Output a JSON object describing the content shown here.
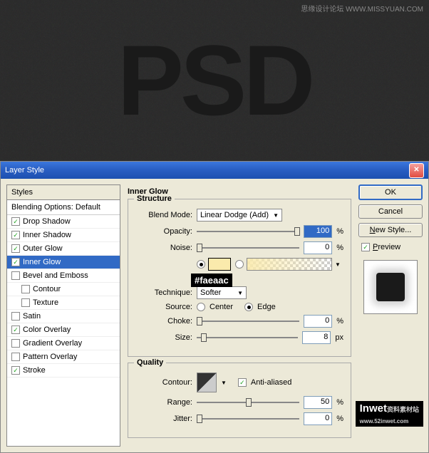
{
  "preview": {
    "text": "PSD",
    "watermark1": "思缘设计论坛 WWW.MISSYUAN.COM",
    "watermark2_brand": "Inwet",
    "watermark2_text": "资料素材站",
    "watermark2_url": "www.52inwet.com"
  },
  "dialog": {
    "title": "Layer Style"
  },
  "styles": {
    "header": "Styles",
    "blending": "Blending Options: Default",
    "items": [
      {
        "label": "Drop Shadow",
        "checked": true,
        "selected": false,
        "indent": false
      },
      {
        "label": "Inner Shadow",
        "checked": true,
        "selected": false,
        "indent": false
      },
      {
        "label": "Outer Glow",
        "checked": true,
        "selected": false,
        "indent": false
      },
      {
        "label": "Inner Glow",
        "checked": true,
        "selected": true,
        "indent": false
      },
      {
        "label": "Bevel and Emboss",
        "checked": false,
        "selected": false,
        "indent": false
      },
      {
        "label": "Contour",
        "checked": false,
        "selected": false,
        "indent": true
      },
      {
        "label": "Texture",
        "checked": false,
        "selected": false,
        "indent": true
      },
      {
        "label": "Satin",
        "checked": false,
        "selected": false,
        "indent": false
      },
      {
        "label": "Color Overlay",
        "checked": true,
        "selected": false,
        "indent": false
      },
      {
        "label": "Gradient Overlay",
        "checked": false,
        "selected": false,
        "indent": false
      },
      {
        "label": "Pattern Overlay",
        "checked": false,
        "selected": false,
        "indent": false
      },
      {
        "label": "Stroke",
        "checked": true,
        "selected": false,
        "indent": false
      }
    ]
  },
  "panel": {
    "title": "Inner Glow",
    "structure": {
      "legend": "Structure",
      "blend_mode_label": "Blend Mode:",
      "blend_mode_value": "Linear Dodge (Add)",
      "opacity_label": "Opacity:",
      "opacity_value": "100",
      "noise_label": "Noise:",
      "noise_value": "0",
      "pct": "%",
      "color_annotation": "#faeaac",
      "technique_label": "Technique:",
      "technique_value": "Softer",
      "source_label": "Source:",
      "source_center": "Center",
      "source_edge": "Edge",
      "choke_label": "Choke:",
      "choke_value": "0",
      "size_label": "Size:",
      "size_value": "8",
      "px": "px"
    },
    "quality": {
      "legend": "Quality",
      "contour_label": "Contour:",
      "antialiased": "Anti-aliased",
      "range_label": "Range:",
      "range_value": "50",
      "jitter_label": "Jitter:",
      "jitter_value": "0",
      "pct": "%"
    }
  },
  "buttons": {
    "ok": "OK",
    "cancel": "Cancel",
    "new_style": "New Style...",
    "preview": "Preview"
  }
}
